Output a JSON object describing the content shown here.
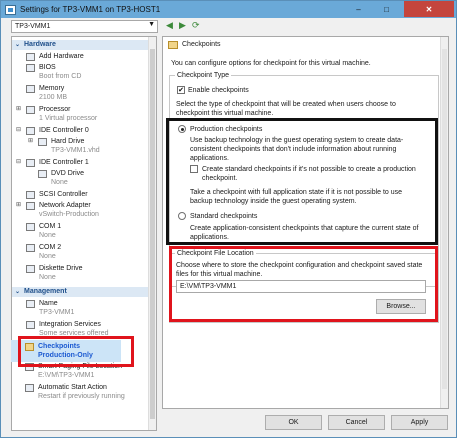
{
  "window": {
    "title": "Settings for TP3-VMM1 on TP3-HOST1",
    "min_glyph": "–",
    "max_glyph": "□",
    "close_glyph": "✕"
  },
  "vm_selector": {
    "value": "TP3-VMM1"
  },
  "tree": {
    "hardware_header": "Hardware",
    "management_header": "Management",
    "items": {
      "add_hardware": "Add Hardware",
      "bios": {
        "label": "BIOS",
        "sub": "Boot from CD"
      },
      "memory": {
        "label": "Memory",
        "sub": "2100 MB"
      },
      "processor": {
        "label": "Processor",
        "sub": "1 Virtual processor"
      },
      "ide0": {
        "label": "IDE Controller 0"
      },
      "hard_drive": {
        "label": "Hard Drive",
        "sub": "TP3-VMM1.vhd"
      },
      "ide1": {
        "label": "IDE Controller 1"
      },
      "dvd": {
        "label": "DVD Drive",
        "sub": "None"
      },
      "scsi": {
        "label": "SCSI Controller"
      },
      "nic": {
        "label": "Network Adapter",
        "sub": "vSwitch-Production"
      },
      "com1": {
        "label": "COM 1",
        "sub": "None"
      },
      "com2": {
        "label": "COM 2",
        "sub": "None"
      },
      "diskette": {
        "label": "Diskette Drive",
        "sub": "None"
      },
      "name": {
        "label": "Name",
        "sub": "TP3-VMM1"
      },
      "integration": {
        "label": "Integration Services",
        "sub": "Some services offered"
      },
      "checkpoints": {
        "label": "Checkpoints",
        "sub": "Production-Only"
      },
      "paging": {
        "label": "Smart Paging File Location",
        "sub": "E:\\VM\\TP3-VMM1"
      },
      "autostart": {
        "label": "Automatic Start Action",
        "sub": "Restart if previously running"
      }
    }
  },
  "panel": {
    "heading": "Checkpoints",
    "intro": "You can configure options for checkpoint for this virtual machine.",
    "type_group": "Checkpoint Type",
    "enable_checkbox": "Enable checkpoints",
    "select_type_text": "Select the type of checkpoint that will be created when users choose to checkpoint this virtual machine.",
    "production_radio": "Production checkpoints",
    "production_desc": "Use backup technology in the guest operating system to create data-consistent checkpoints that don't include information about running applications.",
    "fallback_checkbox": "Create standard checkpoints if it's not possible to create a production checkpoint.",
    "full_state_desc": "Take a checkpoint with full application state if it is not possible to use backup technology inside the guest operating system.",
    "standard_radio": "Standard checkpoints",
    "standard_desc": "Create application-consistent checkpoints that capture the current state of applications.",
    "file_location_group": "Checkpoint File Location",
    "file_location_desc": "Choose where to store the checkpoint configuration and checkpoint saved state files for this virtual machine.",
    "file_path": "E:\\VM\\TP3-VMM1",
    "browse_button": "Browse..."
  },
  "footer": {
    "ok": "OK",
    "cancel": "Cancel",
    "apply": "Apply"
  },
  "colors": {
    "annotation_red": "#e0141c",
    "annotation_black": "#111111",
    "selection": "#cce4f7"
  }
}
